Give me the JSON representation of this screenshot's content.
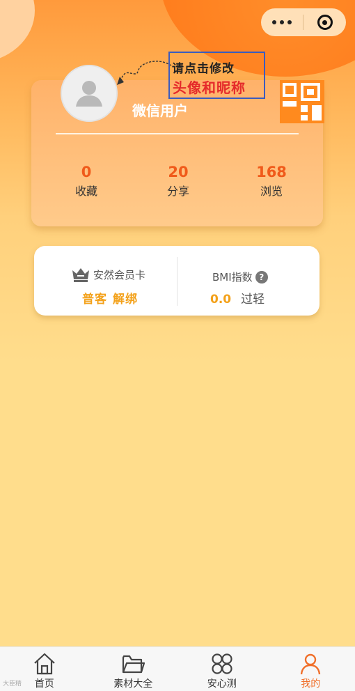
{
  "profile": {
    "nickname": "微信用户",
    "stats": [
      {
        "value": "0",
        "label": "收藏"
      },
      {
        "value": "20",
        "label": "分享"
      },
      {
        "value": "168",
        "label": "浏览"
      }
    ]
  },
  "annotation": {
    "line1": "请点击修改",
    "line2": "头像和昵称"
  },
  "member": {
    "title": "安然会员卡",
    "level": "普客",
    "unbind": "解绑"
  },
  "bmi": {
    "title": "BMI指数",
    "help": "?",
    "value": "0.0",
    "status": "过轻"
  },
  "tabs": [
    {
      "label": "首页",
      "icon": "home-icon"
    },
    {
      "label": "素材大全",
      "icon": "folder-icon"
    },
    {
      "label": "安心测",
      "icon": "grid-icon"
    },
    {
      "label": "我的",
      "icon": "user-icon",
      "active": true
    }
  ],
  "watermark": "大臣精",
  "colors": {
    "accent": "#f06f2a",
    "stat_number": "#f05a1a",
    "member_gold": "#f3a11a",
    "background": "#ffdd8c"
  }
}
